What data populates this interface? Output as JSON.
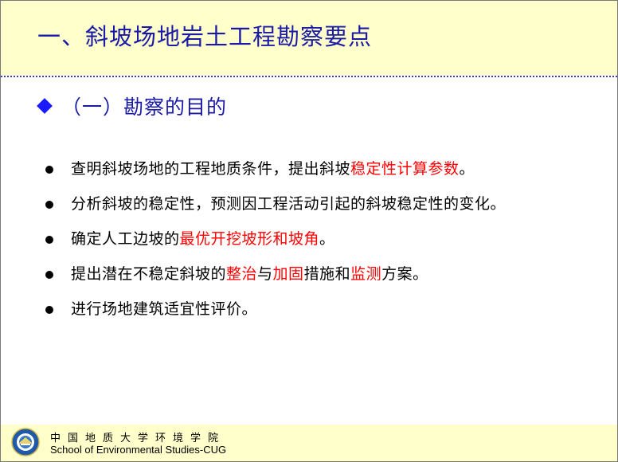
{
  "slide": {
    "title": "一、斜坡场地岩土工程勘察要点",
    "subheading": "（一）勘察的目的",
    "bullets": [
      {
        "segments": [
          {
            "text": "查明斜坡场地的工程地质条件，提出斜坡",
            "red": false
          },
          {
            "text": "稳定性计算参数",
            "red": true
          },
          {
            "text": "。",
            "red": false
          }
        ]
      },
      {
        "segments": [
          {
            "text": "分析斜坡的稳定性，预测因工程活动引起的斜坡稳定性的变化。",
            "red": false
          }
        ]
      },
      {
        "segments": [
          {
            "text": "确定人工边坡的",
            "red": false
          },
          {
            "text": "最优开挖坡形和坡角",
            "red": true
          },
          {
            "text": "。",
            "red": false
          }
        ]
      },
      {
        "segments": [
          {
            "text": "提出潜在不稳定斜坡的",
            "red": false
          },
          {
            "text": "整治",
            "red": true
          },
          {
            "text": "与",
            "red": false
          },
          {
            "text": "加固",
            "red": true
          },
          {
            "text": "措施和",
            "red": false
          },
          {
            "text": "监测",
            "red": true
          },
          {
            "text": "方案。",
            "red": false
          }
        ]
      },
      {
        "segments": [
          {
            "text": "进行场地建筑适宜性评价。",
            "red": false
          }
        ]
      }
    ]
  },
  "footer": {
    "institution_cn": "中国地质大学环境学院",
    "institution_en": "School of Environmental Studies-CUG",
    "logo_icon": "university-seal-icon"
  },
  "colors": {
    "title": "#1a1aa6",
    "band": "#ffffcc",
    "emphasis": "#ff0000",
    "diamond": "#1a1aff"
  }
}
